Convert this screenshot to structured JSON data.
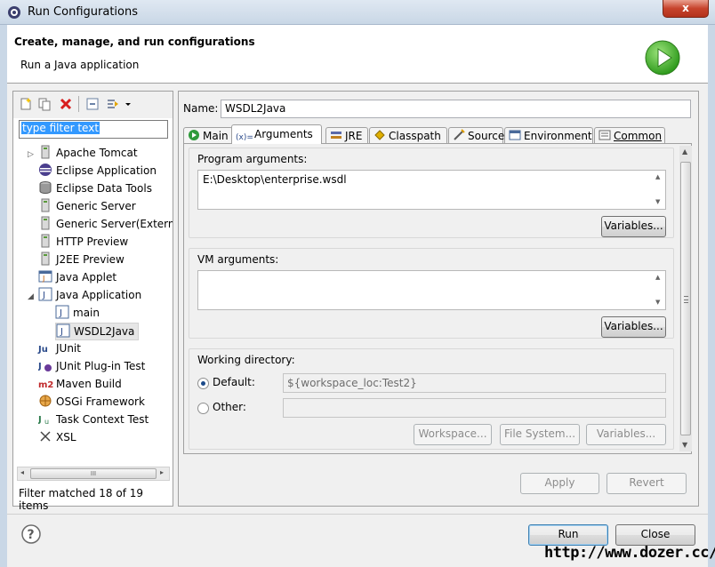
{
  "window": {
    "title": "Run Configurations",
    "close_label": "x"
  },
  "header": {
    "heading": "Create, manage, and run configurations",
    "subheading": "Run a Java application"
  },
  "sidebar": {
    "filter_text": "type filter text",
    "items": [
      {
        "label": "Apache Tomcat",
        "icon": "tomcat-icon"
      },
      {
        "label": "Eclipse Application",
        "icon": "eclipse-icon"
      },
      {
        "label": "Eclipse Data Tools",
        "icon": "database-icon"
      },
      {
        "label": "Generic Server",
        "icon": "server-icon"
      },
      {
        "label": "Generic Server(Extern",
        "icon": "server-icon"
      },
      {
        "label": "HTTP Preview",
        "icon": "server-icon"
      },
      {
        "label": "J2EE Preview",
        "icon": "server-icon"
      },
      {
        "label": "Java Applet",
        "icon": "applet-icon"
      },
      {
        "label": "Java Application",
        "icon": "java-app-icon"
      },
      {
        "label": "main",
        "icon": "java-app-icon"
      },
      {
        "label": "WSDL2Java",
        "icon": "java-app-icon"
      },
      {
        "label": "JUnit",
        "icon": "junit-icon"
      },
      {
        "label": "JUnit Plug-in Test",
        "icon": "junit-plugin-icon"
      },
      {
        "label": "Maven Build",
        "icon": "maven-icon"
      },
      {
        "label": "OSGi Framework",
        "icon": "osgi-icon"
      },
      {
        "label": "Task Context Test",
        "icon": "junit-icon"
      },
      {
        "label": "XSL",
        "icon": "xsl-icon"
      }
    ],
    "matched_text": "Filter matched 18 of 19 items",
    "scroll_grip": "III",
    "maven_badge": "m2",
    "junit_badge": "Ju"
  },
  "form": {
    "name_label": "Name:",
    "name_value": "WSDL2Java",
    "tabs": [
      {
        "label": "Main"
      },
      {
        "label": "Arguments"
      },
      {
        "label": "JRE"
      },
      {
        "label": "Classpath"
      },
      {
        "label": "Source"
      },
      {
        "label": "Environment"
      },
      {
        "label": "Common"
      }
    ],
    "program_args_label": "Program arguments:",
    "program_args_value": "E:\\Desktop\\enterprise.wsdl",
    "variables_label": "Variables...",
    "vm_args_label": "VM arguments:",
    "vm_args_value": "",
    "working_dir_label": "Working directory:",
    "default_label": "Default:",
    "default_value": "${workspace_loc:Test2}",
    "other_label": "Other:",
    "other_value": "",
    "workspace_label": "Workspace...",
    "filesystem_label": "File System...",
    "apply_label": "Apply",
    "revert_label": "Revert"
  },
  "footer": {
    "run_label": "Run",
    "close_label": "Close",
    "watermark": "http://www.dozer.cc/"
  }
}
